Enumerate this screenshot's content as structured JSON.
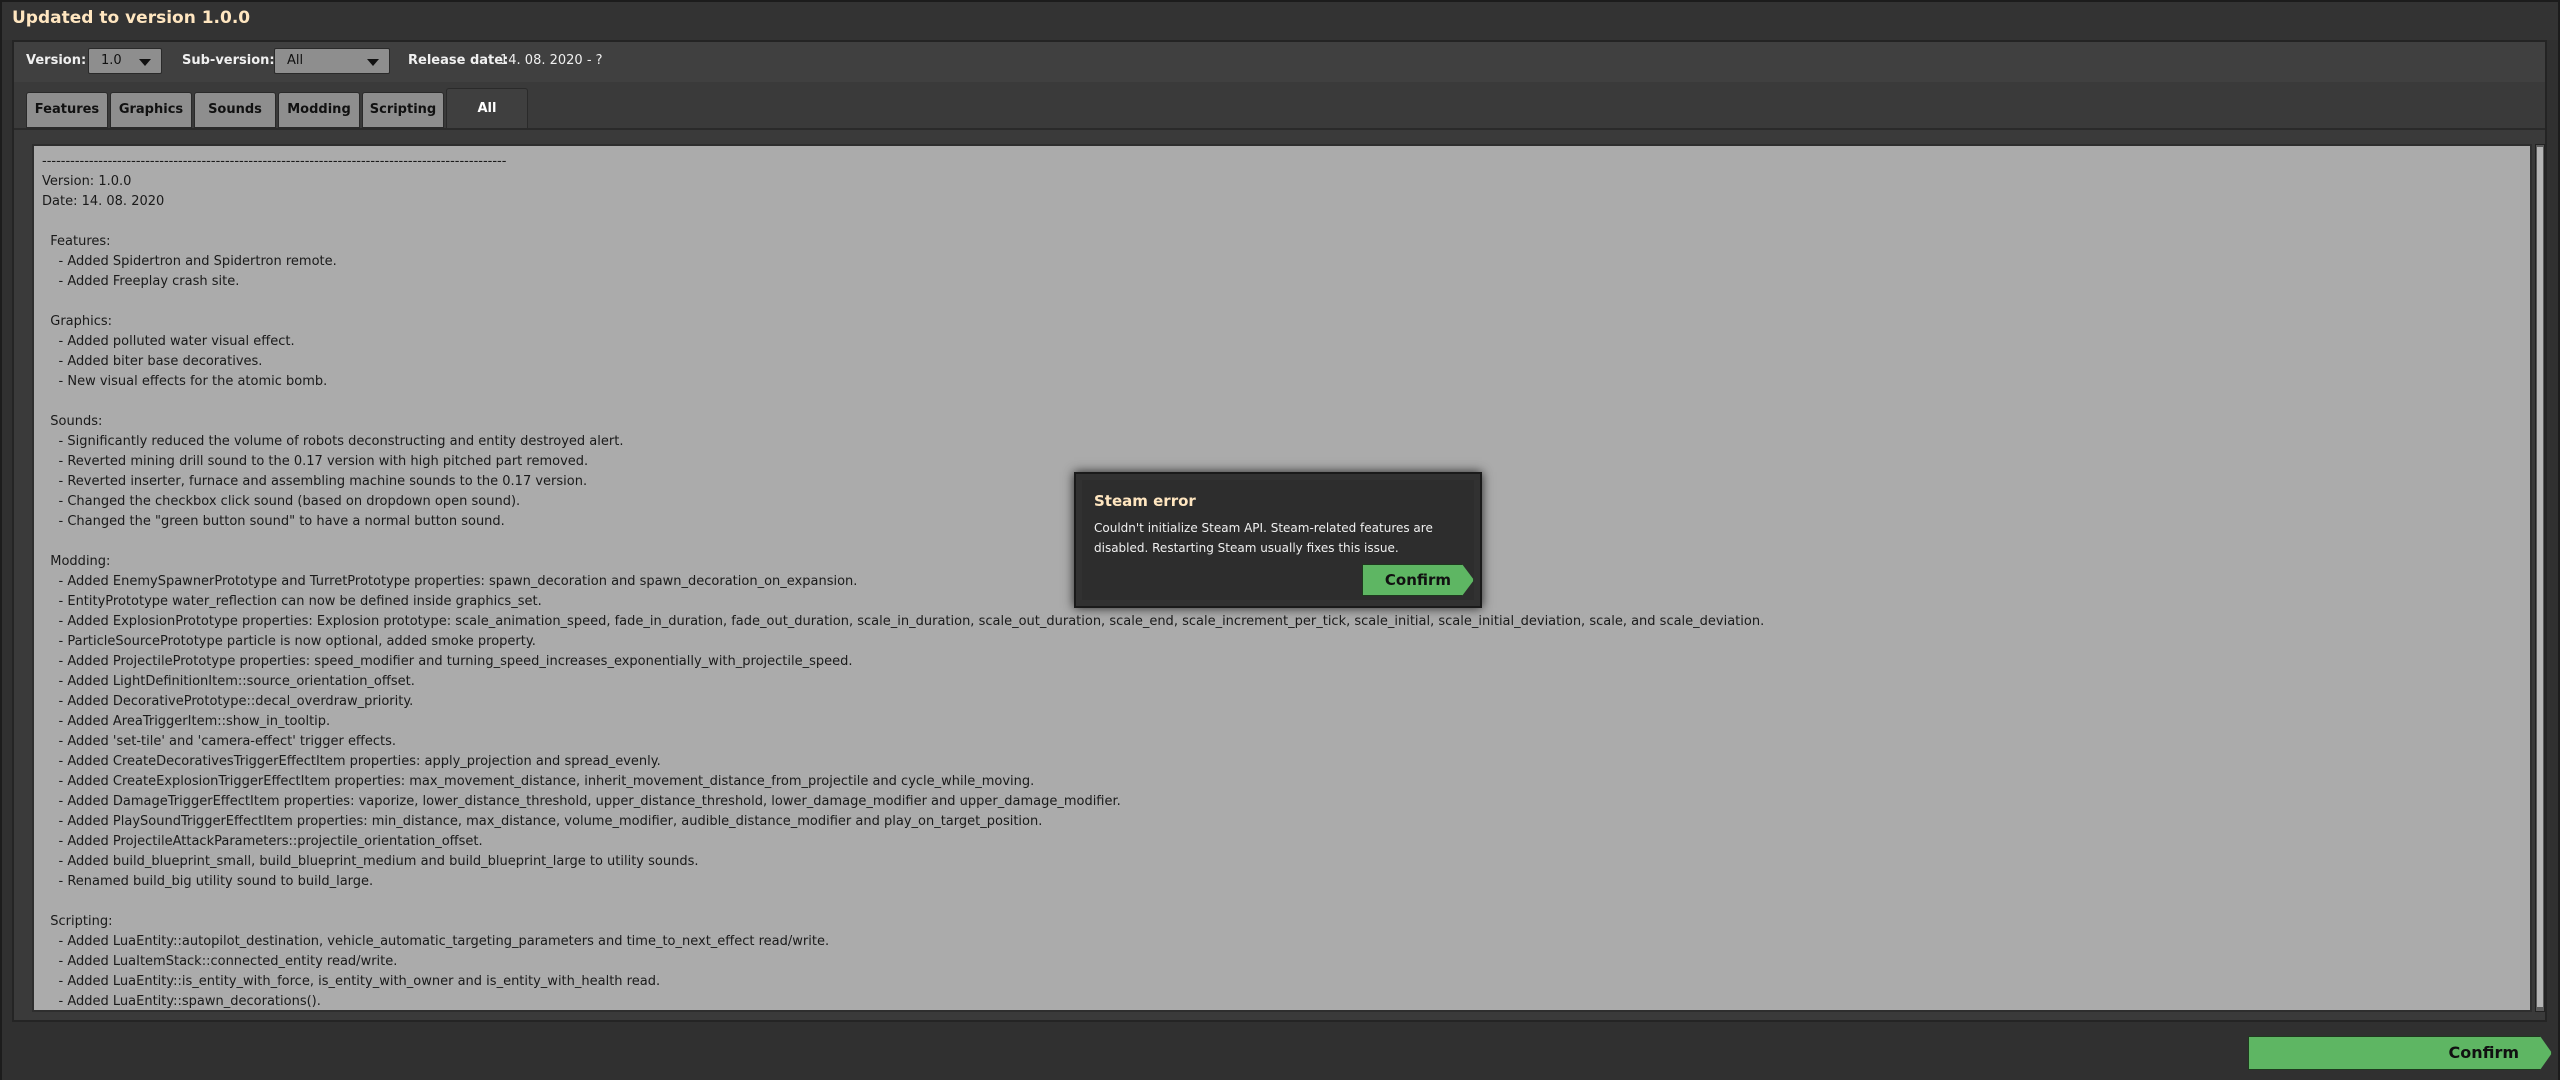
{
  "window": {
    "title": "Updated to version 1.0.0"
  },
  "toolbar": {
    "version_label": "Version:",
    "version_value": "1.0",
    "subversion_label": "Sub-version:",
    "subversion_value": "All",
    "release_label": "Release date:",
    "release_value": "14. 08. 2020 - ?"
  },
  "tabs": [
    {
      "label": "Features"
    },
    {
      "label": "Graphics"
    },
    {
      "label": "Sounds"
    },
    {
      "label": "Modding"
    },
    {
      "label": "Scripting"
    },
    {
      "label": "All",
      "active": true
    }
  ],
  "changelog_lines": [
    "---------------------------------------------------------------------------------------------------",
    "Version: 1.0.0",
    "Date: 14. 08. 2020",
    "",
    "  Features:",
    "    - Added Spidertron and Spidertron remote.",
    "    - Added Freeplay crash site.",
    "",
    "  Graphics:",
    "    - Added polluted water visual effect.",
    "    - Added biter base decoratives.",
    "    - New visual effects for the atomic bomb.",
    "",
    "  Sounds:",
    "    - Significantly reduced the volume of robots deconstructing and entity destroyed alert.",
    "    - Reverted mining drill sound to the 0.17 version with high pitched part removed.",
    "    - Reverted inserter, furnace and assembling machine sounds to the 0.17 version.",
    "    - Changed the checkbox click sound (based on dropdown open sound).",
    "    - Changed the \"green button sound\" to have a normal button sound.",
    "",
    "  Modding:",
    "    - Added EnemySpawnerPrototype and TurretPrototype properties: spawn_decoration and spawn_decoration_on_expansion.",
    "    - EntityPrototype water_reflection can now be defined inside graphics_set.",
    "    - Added ExplosionPrototype properties: Explosion prototype: scale_animation_speed, fade_in_duration, fade_out_duration, scale_in_duration, scale_out_duration, scale_end, scale_increment_per_tick, scale_initial, scale_initial_deviation, scale, and scale_deviation.",
    "    - ParticleSourcePrototype particle is now optional, added smoke property.",
    "    - Added ProjectilePrototype properties: speed_modifier and turning_speed_increases_exponentially_with_projectile_speed.",
    "    - Added LightDefinitionItem::source_orientation_offset.",
    "    - Added DecorativePrototype::decal_overdraw_priority.",
    "    - Added AreaTriggerItem::show_in_tooltip.",
    "    - Added 'set-tile' and 'camera-effect' trigger effects.",
    "    - Added CreateDecorativesTriggerEffectItem properties: apply_projection and spread_evenly.",
    "    - Added CreateExplosionTriggerEffectItem properties: max_movement_distance, inherit_movement_distance_from_projectile and cycle_while_moving.",
    "    - Added DamageTriggerEffectItem properties: vaporize, lower_distance_threshold, upper_distance_threshold, lower_damage_modifier and upper_damage_modifier.",
    "    - Added PlaySoundTriggerEffectItem properties: min_distance, max_distance, volume_modifier, audible_distance_modifier and play_on_target_position.",
    "    - Added ProjectileAttackParameters::projectile_orientation_offset.",
    "    - Added build_blueprint_small, build_blueprint_medium and build_blueprint_large to utility sounds.",
    "    - Renamed build_big utility sound to build_large.",
    "",
    "  Scripting:",
    "    - Added LuaEntity::autopilot_destination, vehicle_automatic_targeting_parameters and time_to_next_effect read/write.",
    "    - Added LuaItemStack::connected_entity read/write.",
    "    - Added LuaEntity::is_entity_with_force, is_entity_with_owner and is_entity_with_health read.",
    "    - Added LuaEntity::spawn_decorations()."
  ],
  "dialog": {
    "title": "Steam error",
    "message": "Couldn't initialize Steam API. Steam-related features are disabled. Restarting Steam usually fixes this issue.",
    "confirm_label": "Confirm"
  },
  "footer": {
    "confirm_label": "Confirm"
  },
  "colors": {
    "title": "#ffe6c0",
    "confirm_green": "#5eb663",
    "content_bg": "#ababab"
  }
}
